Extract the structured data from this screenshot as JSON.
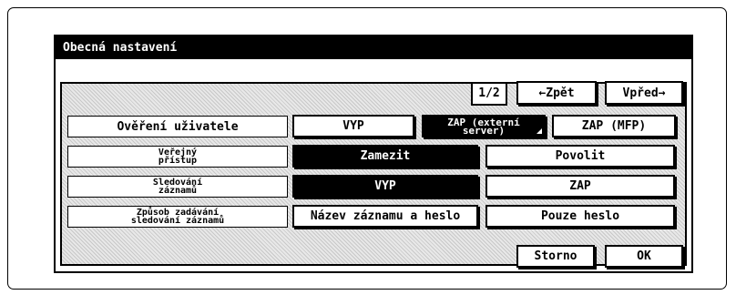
{
  "window": {
    "title": "Obecná nastavení"
  },
  "navigation": {
    "page_indicator": "1/2",
    "back_label": "←Zpět",
    "forward_label": "Vpřed→"
  },
  "rows": [
    {
      "label": "Ověření uživatele",
      "options": [
        "VYP",
        "ZAP (externí\nserver)",
        "ZAP (MFP)"
      ],
      "selected": 1
    },
    {
      "label": "Veřejný\npřístup",
      "options": [
        "Zamezit",
        "Povolit"
      ],
      "selected": 0
    },
    {
      "label": "Sledování\nzáznamů",
      "options": [
        "VYP",
        "ZAP"
      ],
      "selected": 0
    },
    {
      "label": "Způsob zadávání\nsledování záznamů",
      "options": [
        "Název záznamu a heslo",
        "Pouze heslo"
      ],
      "selected": -1
    }
  ],
  "footer": {
    "cancel_label": "Storno",
    "ok_label": "OK"
  }
}
